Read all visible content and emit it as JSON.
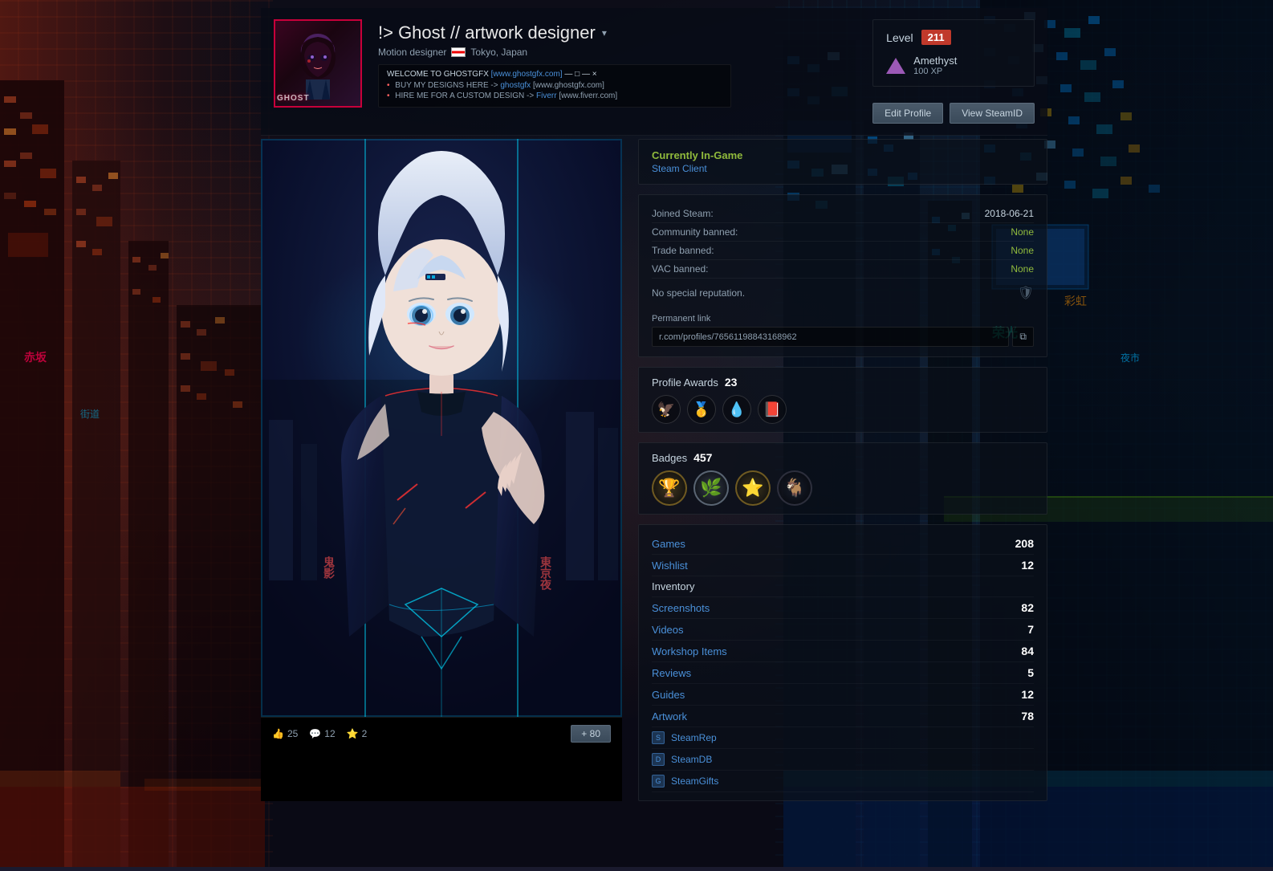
{
  "background": {
    "leftColor": "#3a0510",
    "rightColor": "#0a3060"
  },
  "profile": {
    "name": "!> Ghost // artwork designer",
    "name_short": "!> Ghost // artwork designer",
    "subtitle": "Motion designer",
    "location": "Tokyo, Japan",
    "avatar_label": "GHOST",
    "summary_title": "WELCOME TO GHOSTGFX",
    "summary_url": "[www.ghostgfx.com]",
    "summary_line1": "BUY MY DESIGNS HERE ->",
    "summary_user1": "ghostgfx",
    "summary_url1": "[www.ghostgfx.com]",
    "summary_line2": "HIRE ME FOR A CUSTOM DESIGN ->",
    "summary_user2": "Fiverr",
    "summary_url2": "[www.fiverr.com]",
    "dropdown_arrow": "▾"
  },
  "level": {
    "label": "Level",
    "value": "211",
    "xp_name": "Amethyst",
    "xp_value": "100 XP"
  },
  "buttons": {
    "edit": "Edit Profile",
    "view": "View SteamID"
  },
  "ingame": {
    "status": "Currently In-Game",
    "game": "Steam Client"
  },
  "details": {
    "joined_label": "Joined Steam:",
    "joined_value": "2018-06-21",
    "community_label": "Community banned:",
    "community_value": "None",
    "trade_label": "Trade banned:",
    "trade_value": "None",
    "vac_label": "VAC banned:",
    "vac_value": "None",
    "reputation_text": "No special reputation.",
    "perm_link_label": "Permanent link",
    "perm_link_value": "r.com/profiles/76561198843168962",
    "copy_icon": "⧉"
  },
  "awards": {
    "label": "Profile Awards",
    "count": "23",
    "items": [
      "🦅",
      "🥇",
      "💧",
      "📕"
    ]
  },
  "badges": {
    "label": "Badges",
    "count": "457",
    "items": [
      {
        "emoji": "🏆",
        "type": "gold"
      },
      {
        "emoji": "🌿",
        "type": "silver"
      },
      {
        "emoji": "⭐",
        "type": "gold"
      },
      {
        "emoji": "🐐",
        "type": "dark"
      }
    ]
  },
  "stats": [
    {
      "label": "Games",
      "count": "208",
      "link": true
    },
    {
      "label": "Wishlist",
      "count": "12",
      "link": true
    },
    {
      "label": "Inventory",
      "count": "",
      "link": true
    },
    {
      "label": "Screenshots",
      "count": "82",
      "link": true
    },
    {
      "label": "Videos",
      "count": "7",
      "link": true
    },
    {
      "label": "Workshop Items",
      "count": "84",
      "link": true
    },
    {
      "label": "Reviews",
      "count": "5",
      "link": true
    },
    {
      "label": "Guides",
      "count": "12",
      "link": true
    },
    {
      "label": "Artwork",
      "count": "78",
      "link": true
    }
  ],
  "external_links": [
    {
      "name": "SteamRep",
      "icon": "S"
    },
    {
      "name": "SteamDB",
      "icon": "D"
    },
    {
      "name": "SteamGifts",
      "icon": "G"
    }
  ],
  "artwork": {
    "likes": "25",
    "comments": "12",
    "awards": "2",
    "more_label": "+ 80"
  }
}
